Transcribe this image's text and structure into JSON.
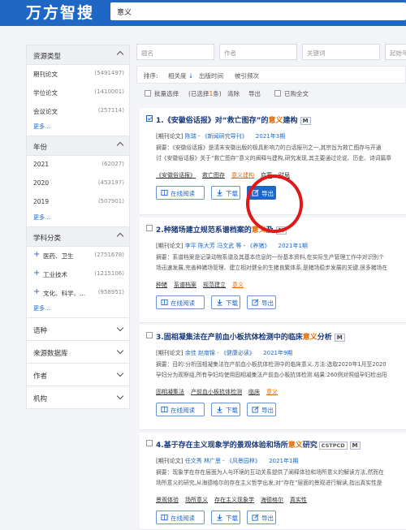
{
  "header": {
    "logo": "万方智搜",
    "query": "意义"
  },
  "sidebar": {
    "resource_type": {
      "title": "资源类型",
      "items": [
        {
          "label": "期刊论文",
          "count": "(5491497)"
        },
        {
          "label": "学位论文",
          "count": "(1410001)"
        },
        {
          "label": "会议论文",
          "count": "(257114)"
        }
      ],
      "more": "更多..."
    },
    "year": {
      "title": "年份",
      "items": [
        {
          "label": "2021",
          "count": "(62027)"
        },
        {
          "label": "2020",
          "count": "(453197)"
        },
        {
          "label": "2019",
          "count": "(507901)"
        }
      ],
      "more": "更多..."
    },
    "subject": {
      "title": "学科分类",
      "items": [
        {
          "label": "医药、卫生",
          "count": "(2751678)"
        },
        {
          "label": "工业技术",
          "count": "(1215106)"
        },
        {
          "label": "文化、科学、...",
          "count": "(958951)"
        }
      ],
      "more": "更多..."
    },
    "collapsed": [
      "语种",
      "来源数据库",
      "作者",
      "机构"
    ]
  },
  "filters": {
    "title": "题名",
    "author": "作者",
    "keyword": "关键词",
    "start_year": "起始年"
  },
  "sortbar": {
    "label": "排序:",
    "relevance": "相关度",
    "pubtime": "出版时间",
    "cited": "被引频次"
  },
  "batchbar": {
    "batch": "批量选择",
    "selected": "(已选择",
    "selected_num": "1",
    "selected_unit": "条)",
    "clear": "清除",
    "export": "导出",
    "only_full": "只显示全文",
    "buy": "已购全文"
  },
  "buttons": {
    "read": "在线阅读",
    "download": "下载",
    "export": "导出"
  },
  "colors": {
    "brand": "#1f67c4",
    "highlight": "#e06a00",
    "annotation_circle": "#e01818"
  },
  "results": [
    {
      "num": "1.",
      "title_pre": "《安徽俗话报》对“救亡图存”的",
      "title_hl": "意义",
      "title_post": "建构",
      "badge": "M",
      "cstpcd": "",
      "type": "[期刊论文]",
      "authors": [
        "陈瑞"
      ],
      "source": "《新闻研究导刊》",
      "date": "2021年3期",
      "abstract1": "摘要：《安徽俗话报》是清末安徽出版的极具影响力的白话报刊之一,其宗旨为救亡图存与开通",
      "abstract2": "讨《安徽俗话报》关于“救亡图存”意义的阐释与建构,研究发现,其主要通过论说、历史、诗词篇章",
      "keywords": [
        {
          "text": "《安徽俗话报》",
          "hl": false
        },
        {
          "text": "救亡图存",
          "hl": false
        },
        {
          "text": "意义建构",
          "hl": true
        },
        {
          "text": "启蒙",
          "hl": false
        },
        {
          "text": "时局",
          "hl": false
        }
      ],
      "checked": true
    },
    {
      "num": "2.",
      "title_pre": "种猪场建立规范系谱档案的",
      "title_hl": "意义",
      "title_post": "及",
      "badge": "M",
      "cstpcd": "",
      "type": "[期刊论文]",
      "authors": [
        "李平",
        "陈大芳",
        "冯文武",
        "等"
      ],
      "source": "《养猪》",
      "date": "2021年1期",
      "abstract1": "摘要：系谱档案是记录动物系谱及其基本信息的一份基本资料,在实际生产管理工作中对识别个",
      "abstract2": "场迅速发展,完善种猪场管理、建立相对健全的生猪良繁体系,是猪场稳步发展的关键,很多猪场在",
      "keywords": [
        {
          "text": "种猪",
          "hl": false
        },
        {
          "text": "系谱档案",
          "hl": false
        },
        {
          "text": "规范建立",
          "hl": false
        },
        {
          "text": "意义",
          "hl": true
        }
      ],
      "checked": false
    },
    {
      "num": "3.",
      "title_pre": "固相凝集法在产前血小板抗体检测中的临床",
      "title_hl": "意义",
      "title_post": "分析",
      "badge": "M",
      "cstpcd": "",
      "type": "[期刊论文]",
      "authors": [
        "余佳",
        "赵南锦"
      ],
      "source": "《健康必读》",
      "date": "2021年9期",
      "abstract1": "摘要：目的:分析固相凝集法在产前血小板抗体检测中的临床意义.方法:选取2020年1月至2020",
      "abstract2": "孕妇分为观察组,所有孕妇均使用固相凝集法产前血小板抗体检测.结果:260例对照组孕妇检出阳",
      "keywords": [
        {
          "text": "固相凝集法",
          "hl": false
        },
        {
          "text": "产前血小板抗体检测",
          "hl": false
        },
        {
          "text": "临床",
          "hl": false
        },
        {
          "text": "意义",
          "hl": true
        }
      ],
      "checked": false
    },
    {
      "num": "4.",
      "title_pre": "基于存在主义现象学的景观体验和场所",
      "title_hl": "意义",
      "title_post": "研究",
      "badge": "M",
      "cstpcd": "CSTPCD",
      "type": "[期刊论文]",
      "authors": [
        "任文秀",
        "林广思"
      ],
      "source": "《风景园林》",
      "date": "2021年1期",
      "abstract1": "摘要：现象学在存在层面为人与环境的互动关系提供了阐释体验和场所意义的解读方法,然而在",
      "abstract2": "场所意义的研究,从海德格尔的存在主义哲学出发,对“存在”层面的景观进行解读,指出真实性是",
      "keywords": [
        {
          "text": "景观体验",
          "hl": false
        },
        {
          "text": "场所意义",
          "hl": false
        },
        {
          "text": "存在主义现象学",
          "hl": false
        },
        {
          "text": "海德格尔",
          "hl": false
        },
        {
          "text": "真实性",
          "hl": false
        }
      ],
      "checked": false
    }
  ]
}
